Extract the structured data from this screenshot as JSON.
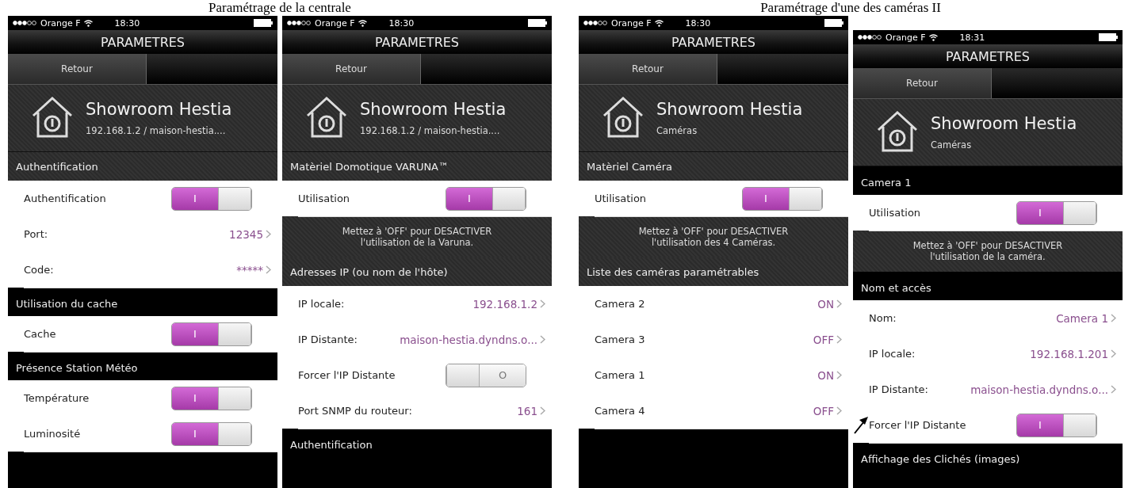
{
  "groups": [
    {
      "caption": "Paramétrage de la centrale",
      "phones": [
        {
          "carrier": "Orange F",
          "time": "18:30",
          "title": "PARAMETRES",
          "back": "Retour",
          "header": {
            "name": "Showroom Hestia",
            "subtitle": "192.168.1.2 / maison-hestia...."
          },
          "items": [
            {
              "kind": "caption",
              "label": "Authentification"
            },
            {
              "kind": "toggle",
              "label": "Authentification",
              "on": true,
              "glyph": "I"
            },
            {
              "kind": "value",
              "label": "Port:",
              "value": "12345"
            },
            {
              "kind": "value",
              "label": "Code:",
              "value": "*****"
            },
            {
              "kind": "section",
              "label": "Utilisation du cache"
            },
            {
              "kind": "toggle",
              "label": "Cache",
              "on": true,
              "glyph": "I"
            },
            {
              "kind": "section",
              "label": "Présence Station Météo"
            },
            {
              "kind": "toggle",
              "label": "Température",
              "on": true,
              "glyph": "I"
            },
            {
              "kind": "toggle",
              "label": "Luminosité",
              "on": true,
              "glyph": "I"
            }
          ]
        },
        {
          "carrier": "Orange F",
          "time": "18:30",
          "title": "PARAMETRES",
          "back": "Retour",
          "header": {
            "name": "Showroom Hestia",
            "subtitle": "192.168.1.2 / maison-hestia...."
          },
          "items": [
            {
              "kind": "caption",
              "label": "Matèriel Domotique VARUNA™"
            },
            {
              "kind": "toggle",
              "label": "Utilisation",
              "on": true,
              "glyph": "I"
            },
            {
              "kind": "note",
              "label": "Mettez à 'OFF' pour DESACTIVER l'utilisation de la Varuna."
            },
            {
              "kind": "caption",
              "label": "Adresses IP (ou nom de l'hôte)"
            },
            {
              "kind": "value",
              "label": "IP locale:",
              "value": "192.168.1.2"
            },
            {
              "kind": "value",
              "label": "IP Distante:",
              "value": "maison-hestia.dyndns.o..."
            },
            {
              "kind": "toggle",
              "label": "Forcer l'IP Distante",
              "on": false,
              "glyph": "O"
            },
            {
              "kind": "value",
              "label": "Port SNMP du routeur:",
              "value": "161"
            },
            {
              "kind": "section",
              "label": "Authentification"
            }
          ]
        }
      ]
    },
    {
      "caption": "Paramétrage d'une des caméras II",
      "phones": [
        {
          "carrier": "Orange F",
          "time": "18:30",
          "title": "PARAMETRES",
          "back": "Retour",
          "header": {
            "name": "Showroom Hestia",
            "subtitle": "Caméras"
          },
          "items": [
            {
              "kind": "caption",
              "label": "Matèriel Caméra"
            },
            {
              "kind": "toggle",
              "label": "Utilisation",
              "on": true,
              "glyph": "I"
            },
            {
              "kind": "note",
              "label": "Mettez à 'OFF' pour DESACTIVER l'utilisation des 4 Caméras."
            },
            {
              "kind": "caption",
              "label": "Liste des caméras paramétrables"
            },
            {
              "kind": "value",
              "label": "Camera 2",
              "value": "ON"
            },
            {
              "kind": "value",
              "label": "Camera 3",
              "value": "OFF"
            },
            {
              "kind": "value",
              "label": "Camera 1",
              "value": "ON"
            },
            {
              "kind": "value",
              "label": "Camera 4",
              "value": "OFF"
            }
          ]
        },
        {
          "carrier": "Orange F",
          "time": "18:31",
          "title": "PARAMETRES",
          "back": "Retour",
          "header": {
            "name": "Showroom Hestia",
            "subtitle": "Caméras"
          },
          "items": [
            {
              "kind": "section",
              "label": "Camera 1"
            },
            {
              "kind": "toggle",
              "label": "Utilisation",
              "on": true,
              "glyph": "I"
            },
            {
              "kind": "note",
              "label": "Mettez à 'OFF' pour DESACTIVER l'utilisation de la caméra."
            },
            {
              "kind": "section",
              "label": "Nom et accès"
            },
            {
              "kind": "value",
              "label": "Nom:",
              "value": "Camera 1"
            },
            {
              "kind": "value",
              "label": "IP locale:",
              "value": "192.168.1.201"
            },
            {
              "kind": "value",
              "label": "IP Distante:",
              "value": "maison-hestia.dyndns.o..."
            },
            {
              "kind": "toggle",
              "label": "Forcer l'IP Distante",
              "on": true,
              "glyph": "I",
              "annotated": true
            },
            {
              "kind": "section",
              "label": "Affichage des Clichés (images)"
            }
          ]
        }
      ]
    }
  ]
}
